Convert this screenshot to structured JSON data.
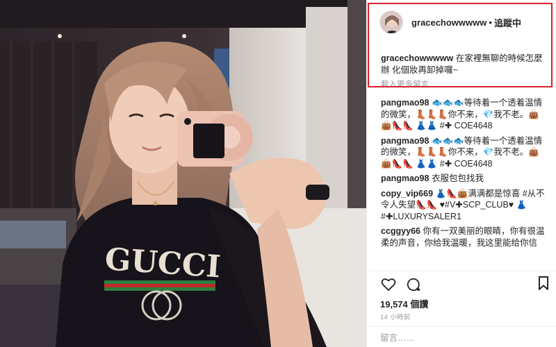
{
  "header": {
    "username": "gracechowwwww",
    "separator": "•",
    "follow_status": "追蹤中"
  },
  "caption": {
    "username": "gracechowwwww",
    "text": "在家裡無聊的時候怎麼辦 化個妝再卸掉囉~"
  },
  "load_more_label": "載入更多留言",
  "comments": [
    {
      "user": "pangmao98",
      "text": "🐟🐟🐟等待着一个透着温情的微笑，👢👢👢你不来，💎我不老。👜👜👠👠 👗👗 #✚ COE4648"
    },
    {
      "user": "pangmao98",
      "text": "🐟🐟🐟等待着一个透着温情的微笑，👢👢👢你不来，💎我不老。👜👜👠👠 👗👗 #✚ COE4648"
    },
    {
      "user": "pangmao98",
      "text": "衣服包包找我"
    },
    {
      "user": "copy_vip669",
      "text": "👗👠👜满满都是惊喜 #从不令人失望👠👠 ♥#V✚SCP_CLUB♥ 👗#✚LUXURYSALER1"
    },
    {
      "user": "ccggyy66",
      "text": "你有一双美丽的眼睛，你有很温柔的声音，你给我温暖，我这里能给你信"
    }
  ],
  "icons": {
    "like": "heart-outline-icon",
    "comment": "speech-bubble-icon",
    "save": "bookmark-icon"
  },
  "likes_label": "19,574 個讚",
  "time_label": "14 小時前",
  "comment_placeholder": "留言……",
  "colors": {
    "highlight_box": "#d8202f",
    "text_primary": "#262626",
    "text_muted": "#999999"
  }
}
